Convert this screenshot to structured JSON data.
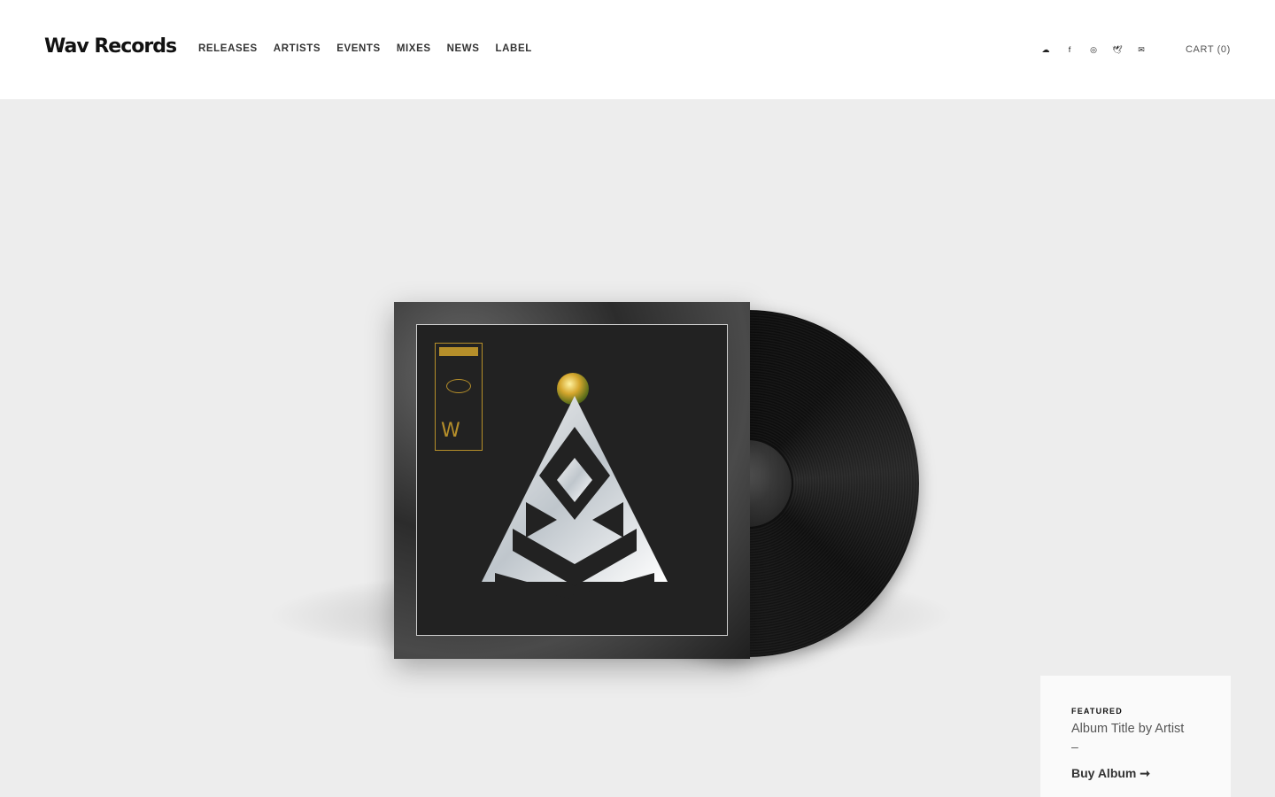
{
  "brand": {
    "name": "Wav Records"
  },
  "nav": {
    "items": [
      {
        "label": "RELEASES"
      },
      {
        "label": "ARTISTS"
      },
      {
        "label": "EVENTS"
      },
      {
        "label": "MIXES"
      },
      {
        "label": "NEWS"
      },
      {
        "label": "LABEL"
      }
    ]
  },
  "social": {
    "icons": [
      {
        "name": "soundcloud-icon",
        "glyph": "☁"
      },
      {
        "name": "facebook-icon",
        "glyph": "f"
      },
      {
        "name": "instagram-icon",
        "glyph": "◎"
      },
      {
        "name": "twitter-icon",
        "glyph": "🕊"
      },
      {
        "name": "email-icon",
        "glyph": "✉"
      }
    ]
  },
  "cart": {
    "label": "CART (0)"
  },
  "featured": {
    "eyebrow": "FEATURED",
    "title": "Album Title by Artist",
    "dash": "–",
    "buy_label": "Buy Album ➞"
  },
  "colors": {
    "accent_gold": "#b68f2a",
    "background": "#ededed",
    "header_bg": "#ffffff"
  }
}
